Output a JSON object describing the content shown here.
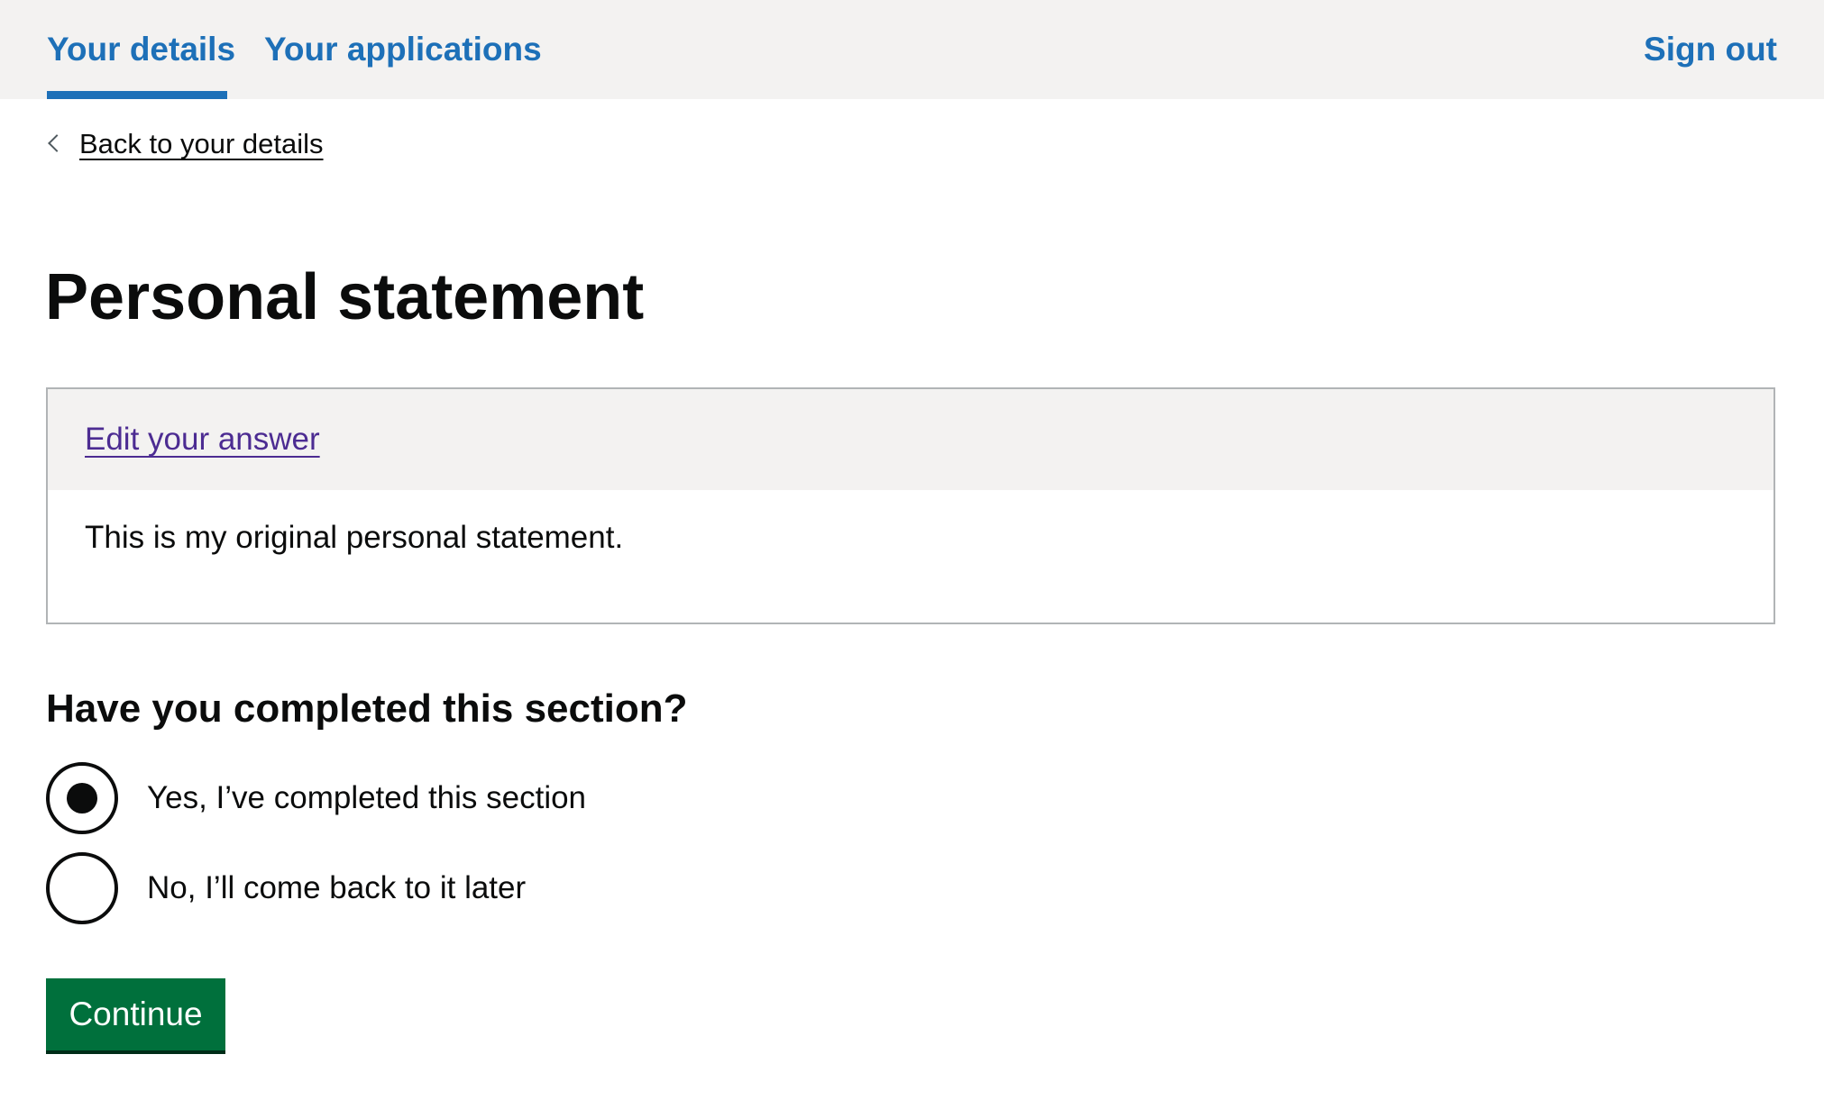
{
  "nav": {
    "items": [
      {
        "label": "Your details",
        "active": true
      },
      {
        "label": "Your applications",
        "active": false
      }
    ],
    "sign_out": "Sign out",
    "link_color": "#1d70b8"
  },
  "back_link": {
    "label": "Back to your details",
    "icon": "chevron-left-icon"
  },
  "page": {
    "title": "Personal statement"
  },
  "answer_box": {
    "edit_label": "Edit your answer",
    "text": "This is my original personal statement."
  },
  "completion": {
    "question": "Have you completed this section?",
    "options": [
      {
        "label": "Yes, I’ve completed this section",
        "selected": true
      },
      {
        "label": "No, I’ll come back to it later",
        "selected": false
      }
    ]
  },
  "continue_label": "Continue",
  "colors": {
    "button": "#00703c",
    "edit_link": "#4c2c92",
    "header_bg": "#f3f2f1"
  }
}
